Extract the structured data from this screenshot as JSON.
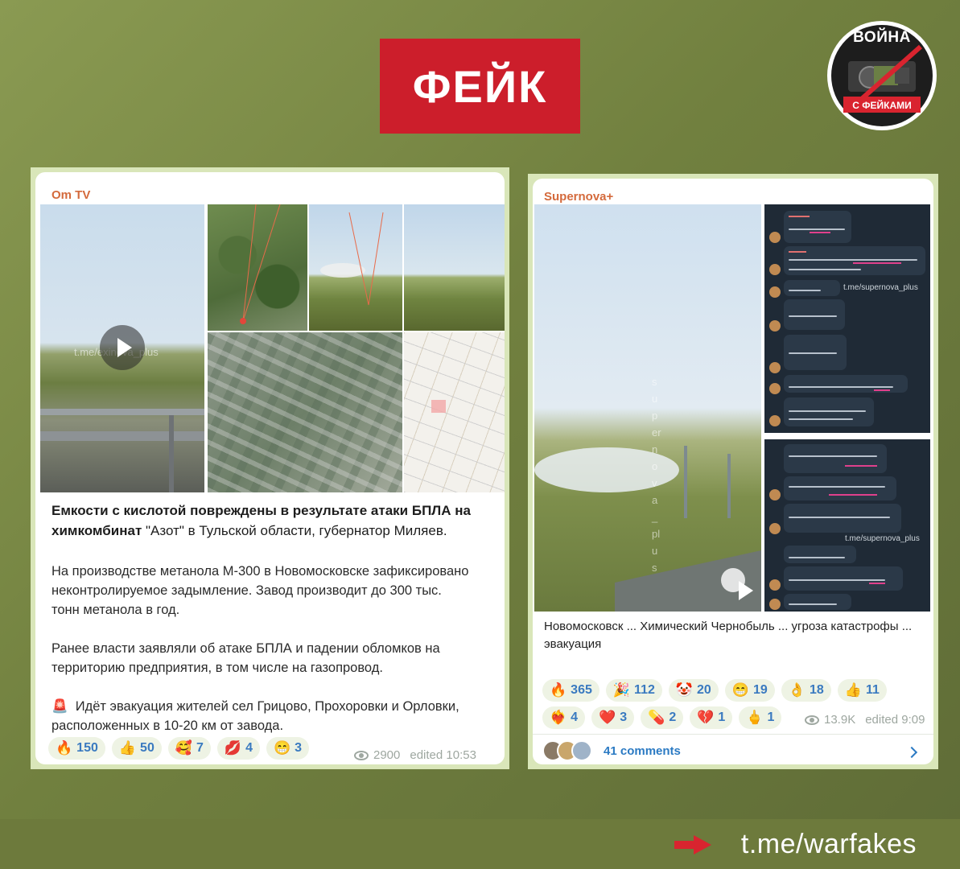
{
  "header": {
    "badge_text": "ФЕЙК",
    "logo_top": "ВОЙНА",
    "logo_bottom": "С ФЕЙКАМИ"
  },
  "footer": {
    "link": "t.me/warfakes"
  },
  "left_post": {
    "channel": "Om TV",
    "title_bold_1": "Емкости с кислотой повреждены в результате атаки БПЛА на химкомбинат",
    "title_plain": " \"Азот\" в Тульской области, губернатор ",
    "title_bold_2": "Миляев.",
    "para1": "На производстве метанола М-300 в Новомосковске зафиксировано неконтролируемое задымление. Завод производит до 300 тыс. тонн метанола в год.",
    "para2": "Ранее власти заявляли об атаке БПЛА и падении обломков на территорию предприятия, в том числе на газопровод.",
    "para3_icon": "🚨",
    "para3": "Идёт эвакуация жителей сел Грицово,  Прохоровки и Орловки, расположенных в 10-20 км от завода.",
    "video_watermark": "t.me/exinova_plus",
    "reactions": [
      {
        "emoji": "🔥",
        "count": "150"
      },
      {
        "emoji": "👍",
        "count": "50"
      },
      {
        "emoji": "🥰",
        "count": "7"
      },
      {
        "emoji": "💋",
        "count": "4"
      },
      {
        "emoji": "😁",
        "count": "3"
      }
    ],
    "views": "2900",
    "edited": "edited 10:53"
  },
  "right_post": {
    "channel": "Supernova+",
    "video_watermark": "supernova_plus",
    "chat_watermark_1": "t.me/supernova_plus",
    "chat_watermark_2": "t.me/supernova_plus",
    "caption": "Новомосковск ...  Химический Чернобыль ... угроза катастрофы ... эвакуация",
    "reactions": [
      {
        "emoji": "🔥",
        "count": "365"
      },
      {
        "emoji": "🎉",
        "count": "112"
      },
      {
        "emoji": "🤡",
        "count": "20"
      },
      {
        "emoji": "😁",
        "count": "19"
      },
      {
        "emoji": "👌",
        "count": "18"
      },
      {
        "emoji": "👍",
        "count": "11"
      },
      {
        "emoji": "❤️‍🔥",
        "count": "4"
      },
      {
        "emoji": "❤️",
        "count": "3"
      },
      {
        "emoji": "💊",
        "count": "2"
      },
      {
        "emoji": "💔",
        "count": "1"
      },
      {
        "emoji": "🖕",
        "count": "1"
      }
    ],
    "views": "13.9K",
    "edited": "edited 9:09",
    "comments": "41 comments"
  },
  "colors": {
    "fake_red": "#cc1e2b",
    "channel_orange": "#d46a3c",
    "link_blue": "#2b7ac3",
    "background_olive": "#71803f"
  }
}
